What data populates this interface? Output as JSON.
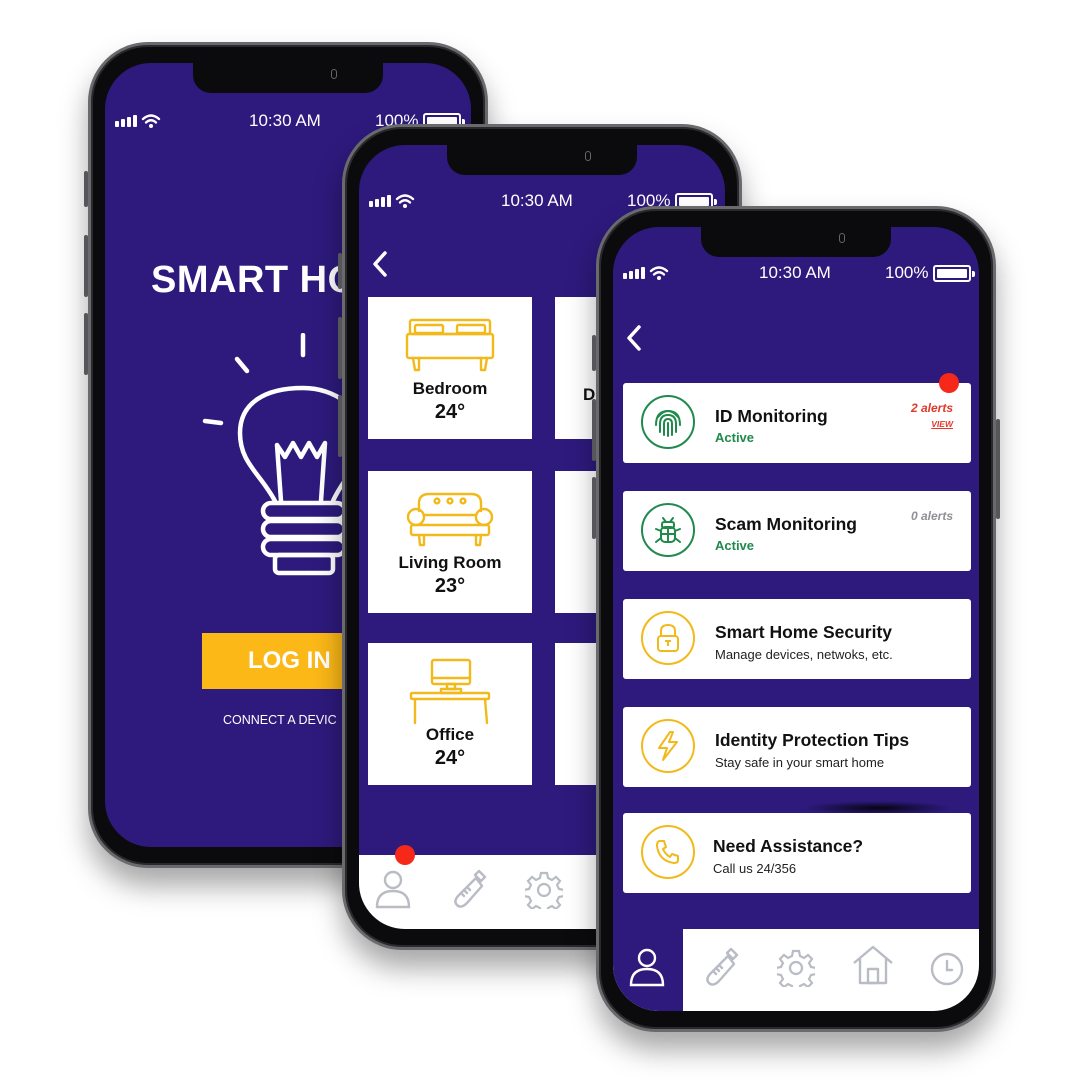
{
  "colors": {
    "screen_bg": "#2d1a7c",
    "accent_yellow": "#fbb817",
    "alert_red": "#f5281a",
    "active_green": "#1f8a4c",
    "tab_icon_gray": "#b9bcc4"
  },
  "status_bar": {
    "time": "10:30 AM",
    "battery_pct": "100%",
    "battery_level": 1.0,
    "signal_icon": "cellular-signal-icon",
    "wifi_icon": "wifi-icon"
  },
  "login_screen": {
    "title": "SMART HO",
    "hero_icon": "lightbulb-icon",
    "login_button": "LOG IN",
    "connect_link": "CONNECT A DEVIC"
  },
  "rooms_screen": {
    "back_icon": "chevron-left-icon",
    "rooms": [
      {
        "name": "Bedroom",
        "temp": "24°",
        "icon": "bed-icon"
      },
      {
        "name": "D",
        "temp": "",
        "icon": ""
      },
      {
        "name": "Living Room",
        "temp": "23°",
        "icon": "sofa-icon"
      },
      {
        "name": "",
        "temp": "",
        "icon": ""
      },
      {
        "name": "Office",
        "temp": "24°",
        "icon": "desk-computer-icon"
      },
      {
        "name": "",
        "temp": "",
        "icon": ""
      }
    ],
    "tabs": [
      {
        "icon": "user-icon",
        "badge": true
      },
      {
        "icon": "baby-bottle-icon",
        "badge": false
      },
      {
        "icon": "gear-icon",
        "badge": false
      }
    ]
  },
  "security_screen": {
    "back_icon": "chevron-left-icon",
    "services": [
      {
        "title": "ID Monitoring",
        "status": "Active",
        "alerts": "2 alerts",
        "view": "VIEW",
        "icon": "fingerprint-icon",
        "badge": true
      },
      {
        "title": "Scam Monitoring",
        "status": "Active",
        "alerts": "0 alerts",
        "icon": "bug-icon",
        "badge": false
      },
      {
        "title": "Smart Home Security",
        "subtitle": "Manage devices, netwoks, etc.",
        "icon": "padlock-icon"
      },
      {
        "title": "Identity Protection Tips",
        "subtitle": "Stay safe in your smart home",
        "icon": "lightning-icon"
      },
      {
        "title": "Need Assistance?",
        "subtitle": "Call us 24/356",
        "icon": "phone-icon"
      }
    ],
    "tabs": [
      {
        "icon": "user-icon",
        "active": true
      },
      {
        "icon": "baby-bottle-icon",
        "active": false
      },
      {
        "icon": "gear-icon",
        "active": false
      },
      {
        "icon": "home-icon",
        "active": false
      },
      {
        "icon": "clock-icon",
        "active": false
      }
    ]
  }
}
